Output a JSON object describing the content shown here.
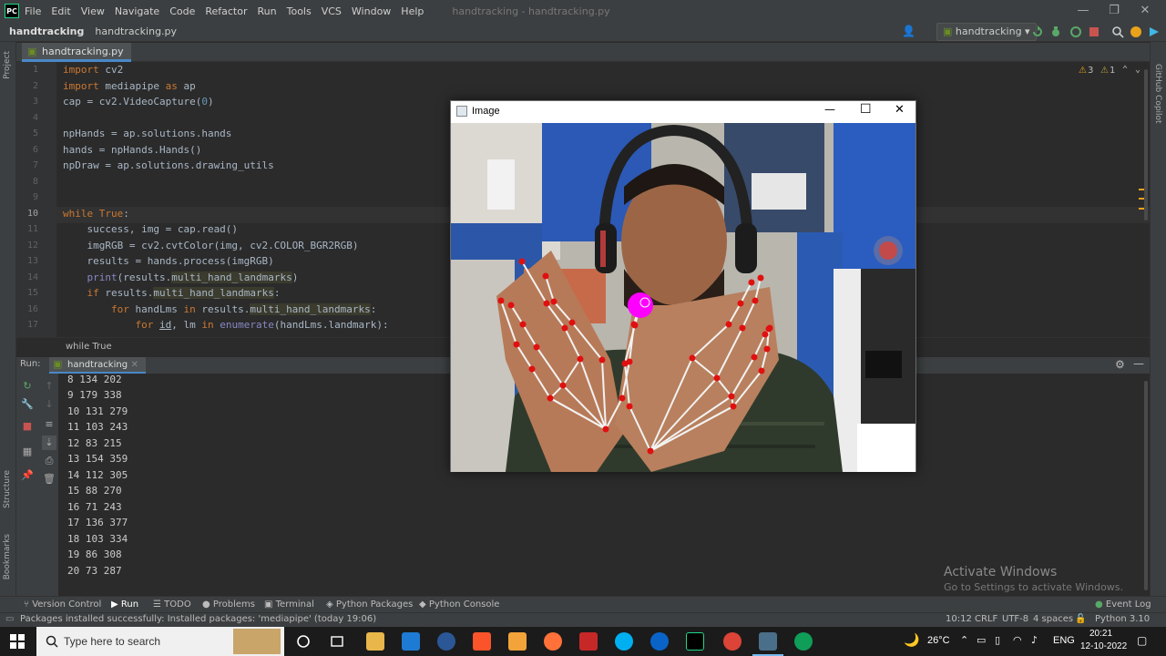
{
  "menubar": {
    "logo": "PC",
    "items": [
      "File",
      "Edit",
      "View",
      "Navigate",
      "Code",
      "Refactor",
      "Run",
      "Tools",
      "VCS",
      "Window",
      "Help"
    ],
    "window_title": "handtracking - handtracking.py",
    "minimize": "—",
    "maximize": "❐",
    "close": "✕"
  },
  "navbar": {
    "project": "handtracking",
    "file": "handtracking.py",
    "run_config": "handtracking"
  },
  "sidebar_left": {
    "project": "Project",
    "structure": "Structure",
    "bookmarks": "Bookmarks"
  },
  "sidebar_right": {
    "copilot": "GitHub Copilot"
  },
  "tabs": [
    {
      "label": "handtracking.py"
    }
  ],
  "editor": {
    "warnings": "3",
    "weak_warnings": "1",
    "line_numbers": [
      "1",
      "2",
      "3",
      "4",
      "5",
      "6",
      "7",
      "8",
      "9",
      "10",
      "11",
      "12",
      "13",
      "14",
      "15",
      "16",
      "17"
    ],
    "breadcrumb": "while True"
  },
  "run": {
    "label": "Run:",
    "tab": "handtracking",
    "output": [
      "8 134 202",
      "9 179 338",
      "10 131 279",
      "11 103 243",
      "12 83 215",
      "13 154 359",
      "14 112 305",
      "15 88 270",
      "16 71 243",
      "17 136 377",
      "18 103 334",
      "19 86 308",
      "20 73 287"
    ]
  },
  "bottom_tabs": [
    "Version Control",
    "Run",
    "TODO",
    "Problems",
    "Terminal",
    "Python Packages",
    "Python Console"
  ],
  "event_log": "Event Log",
  "status": {
    "message": "Packages installed successfully: Installed packages: 'mediapipe' (today 19:06)",
    "position": "10:12",
    "line_sep": "CRLF",
    "encoding": "UTF-8",
    "indent": "4 spaces",
    "interpreter": "Python 3.10"
  },
  "cv_window": {
    "title": "Image",
    "minimize": "—",
    "maximize": "☐",
    "close": "✕"
  },
  "activation": {
    "title": "Activate Windows",
    "subtitle": "Go to Settings to activate Windows."
  },
  "taskbar": {
    "search_placeholder": "Type here to search",
    "weather": "26°C",
    "language": "ENG",
    "time": "20:21",
    "date": "12-10-2022"
  },
  "colors": {
    "ide_bg": "#2b2b2b",
    "panel_bg": "#3c3f41",
    "keyword": "#cc7832",
    "number": "#6897bb",
    "landmark": "#ff0000",
    "fingertip": "#ff00ff"
  }
}
